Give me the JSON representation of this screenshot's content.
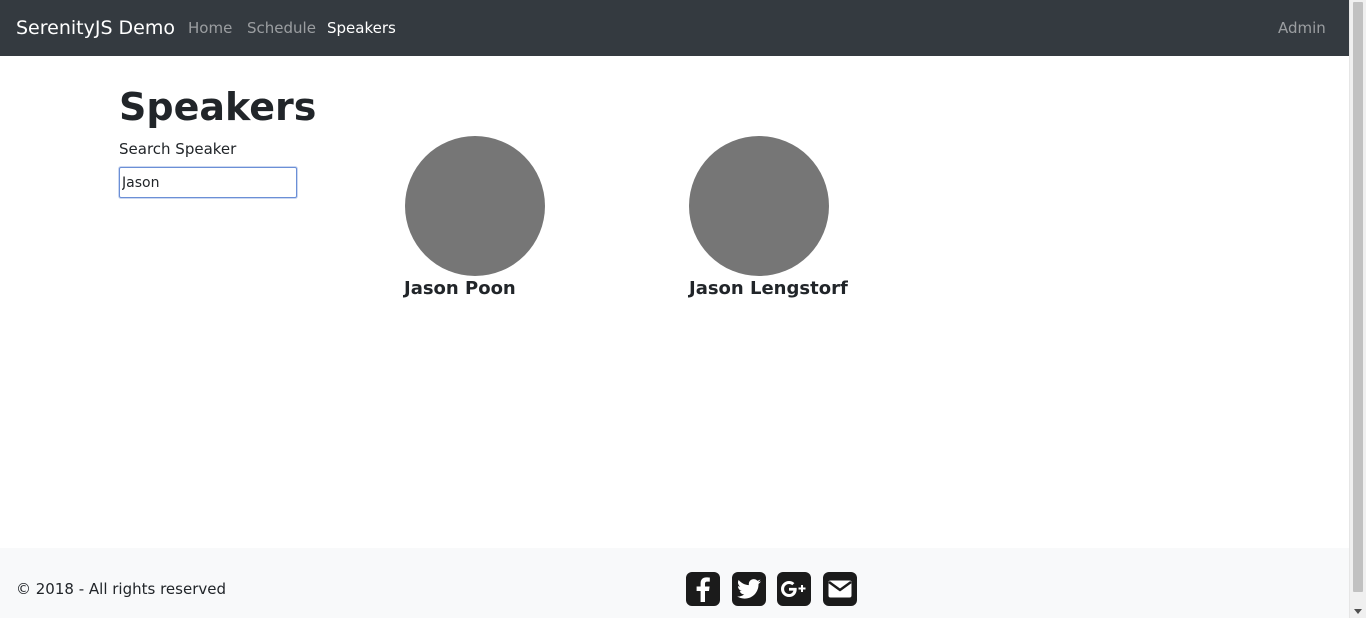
{
  "navbar": {
    "brand": "SerenityJS Demo",
    "links": [
      {
        "label": "Home",
        "active": false
      },
      {
        "label": "Schedule",
        "active": false
      },
      {
        "label": "Speakers",
        "active": true
      }
    ],
    "admin_label": "Admin"
  },
  "main": {
    "title": "Speakers",
    "search": {
      "label": "Search Speaker",
      "value": "Jason"
    },
    "speakers": [
      {
        "name": "Jason Poon"
      },
      {
        "name": "Jason Lengstorf"
      }
    ]
  },
  "footer": {
    "copyright": "© 2018 - All rights reserved",
    "social_icons": [
      "facebook-icon",
      "twitter-icon",
      "google-plus-icon",
      "email-icon"
    ]
  },
  "colors": {
    "navbar_bg": "#343a40",
    "footer_bg": "#f8f9fa",
    "avatar_placeholder": "#767676",
    "input_focus_border": "#6b8fd6"
  }
}
